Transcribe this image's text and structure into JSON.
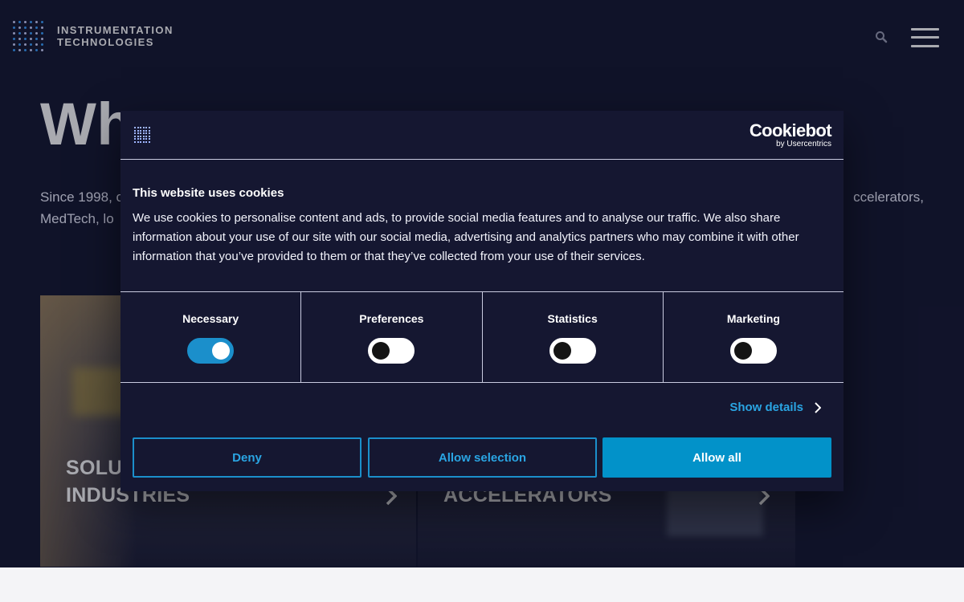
{
  "header": {
    "logo_line1": "INSTRUMENTATION",
    "logo_line2": "TECHNOLOGIES",
    "search_icon": "search-icon",
    "menu_icon": "hamburger-menu-icon"
  },
  "hero": {
    "title_visible": "Wh                                                                ogy",
    "text_left": "Since 1998, o",
    "text_right": "ccelerators,",
    "text_line2": "MedTech, lo"
  },
  "cards": [
    {
      "line1": "SOLU",
      "line2": "INDUSTRIES"
    },
    {
      "line1": "",
      "line2": "ACCELERATORS"
    }
  ],
  "cookie_dialog": {
    "brand_main": "Cookiebot",
    "brand_sub": "by Usercentrics",
    "title": "This website uses cookies",
    "body": "We use cookies to personalise content and ads, to provide social media features and to analyse our traffic. We also share information about your use of our site with our social media, advertising and analytics partners who may combine it with other information that you’ve provided to them or that they’ve collected from your use of their services.",
    "categories": [
      {
        "label": "Necessary",
        "enabled": true
      },
      {
        "label": "Preferences",
        "enabled": false
      },
      {
        "label": "Statistics",
        "enabled": false
      },
      {
        "label": "Marketing",
        "enabled": false
      }
    ],
    "show_details": "Show details",
    "buttons": {
      "deny": "Deny",
      "allow_selection": "Allow selection",
      "allow_all": "Allow all"
    }
  },
  "colors": {
    "background": "#151731",
    "accent": "#0292c9",
    "link": "#2aa5e3"
  }
}
